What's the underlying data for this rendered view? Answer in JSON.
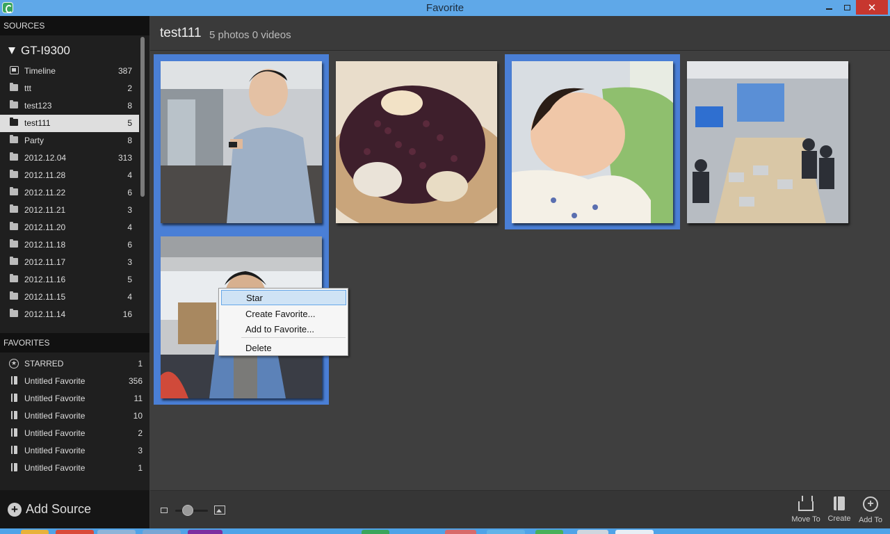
{
  "window": {
    "title": "Favorite"
  },
  "sidebar": {
    "sources_header": "SOURCES",
    "device": "GT-I9300",
    "sources": [
      {
        "label": "Timeline",
        "count": "387",
        "icon": "timeline-icon"
      },
      {
        "label": "ttt",
        "count": "2",
        "icon": "folder-icon"
      },
      {
        "label": "test123",
        "count": "8",
        "icon": "folder-icon"
      },
      {
        "label": "test111",
        "count": "5",
        "icon": "folder-open-icon",
        "selected": true
      },
      {
        "label": "Party",
        "count": "8",
        "icon": "folder-icon"
      },
      {
        "label": "2012.12.04",
        "count": "313",
        "icon": "folder-icon"
      },
      {
        "label": "2012.11.28",
        "count": "4",
        "icon": "folder-icon"
      },
      {
        "label": "2012.11.22",
        "count": "6",
        "icon": "folder-icon"
      },
      {
        "label": "2012.11.21",
        "count": "3",
        "icon": "folder-icon"
      },
      {
        "label": "2012.11.20",
        "count": "4",
        "icon": "folder-icon"
      },
      {
        "label": "2012.11.18",
        "count": "6",
        "icon": "folder-icon"
      },
      {
        "label": "2012.11.17",
        "count": "3",
        "icon": "folder-icon"
      },
      {
        "label": "2012.11.16",
        "count": "5",
        "icon": "folder-icon"
      },
      {
        "label": "2012.11.15",
        "count": "4",
        "icon": "folder-icon"
      },
      {
        "label": "2012.11.14",
        "count": "16",
        "icon": "folder-icon"
      }
    ],
    "favorites_header": "FAVORITES",
    "favorites": [
      {
        "label": "STARRED",
        "count": "1",
        "icon": "star-icon"
      },
      {
        "label": "Untitled Favorite",
        "count": "356",
        "icon": "book-icon"
      },
      {
        "label": "Untitled Favorite",
        "count": "11",
        "icon": "book-icon"
      },
      {
        "label": "Untitled Favorite",
        "count": "10",
        "icon": "book-icon"
      },
      {
        "label": "Untitled Favorite",
        "count": "2",
        "icon": "book-icon"
      },
      {
        "label": "Untitled Favorite",
        "count": "3",
        "icon": "book-icon"
      },
      {
        "label": "Untitled Favorite",
        "count": "1",
        "icon": "book-icon"
      }
    ],
    "add_source": "Add Source"
  },
  "album": {
    "title": "test111",
    "stats": "5 photos 0 videos"
  },
  "photos": [
    {
      "subject": "man-with-phone",
      "selected": true
    },
    {
      "subject": "red-bean-dessert",
      "selected": false
    },
    {
      "subject": "sleeping-baby",
      "selected": true
    },
    {
      "subject": "meeting-room",
      "selected": false
    },
    {
      "subject": "man-in-office",
      "selected": true
    }
  ],
  "context_menu": {
    "items": [
      "Star",
      "Create Favorite...",
      "Add to Favorite...",
      "Delete"
    ],
    "highlighted": "Star"
  },
  "toolbar": {
    "move_to": "Move To",
    "create": "Create",
    "add_to": "Add To",
    "zoom_level": 0.3
  },
  "colors": {
    "titlebar": "#5fa8e8",
    "selection": "#4a7fd6",
    "close": "#c7372f"
  }
}
